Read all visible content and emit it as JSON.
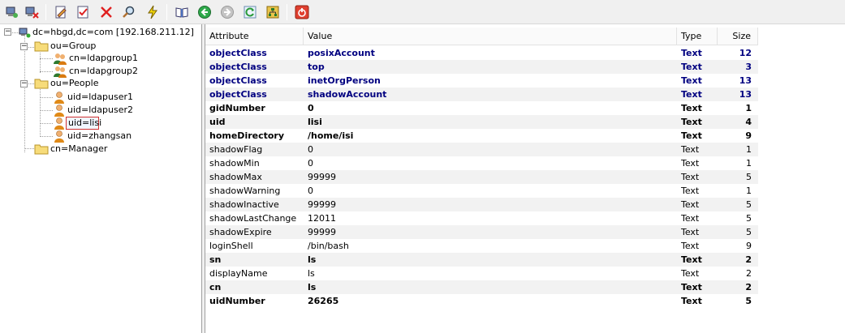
{
  "toolbar": {
    "buttons": [
      {
        "name": "connect-icon"
      },
      {
        "name": "disconnect-icon"
      },
      {
        "name": "edit-entry-icon"
      },
      {
        "name": "save-entry-icon"
      },
      {
        "name": "delete-icon"
      },
      {
        "name": "search-icon"
      },
      {
        "name": "execute-icon"
      },
      {
        "name": "book-icon"
      },
      {
        "name": "back-icon"
      },
      {
        "name": "forward-icon"
      },
      {
        "name": "refresh-icon"
      },
      {
        "name": "tree-view-icon"
      },
      {
        "name": "power-icon"
      }
    ]
  },
  "tree": {
    "root": "dc=hbgd,dc=com [192.168.211.12]",
    "group": "ou=Group",
    "group_items": [
      "cn=ldapgroup1",
      "cn=ldapgroup2"
    ],
    "people": "ou=People",
    "people_items": [
      "uid=ldapuser1",
      "uid=ldapuser2",
      "uid=lisi",
      "uid=zhangsan"
    ],
    "manager": "cn=Manager",
    "expanded_marker": "−"
  },
  "table": {
    "headers": {
      "attribute": "Attribute",
      "value": "Value",
      "type": "Type",
      "size": "Size"
    },
    "rows": [
      {
        "attr": "objectClass",
        "value": "posixAccount",
        "type": "Text",
        "size": "12",
        "style": "oc"
      },
      {
        "attr": "objectClass",
        "value": "top",
        "type": "Text",
        "size": "3",
        "style": "oc"
      },
      {
        "attr": "objectClass",
        "value": "inetOrgPerson",
        "type": "Text",
        "size": "13",
        "style": "oc"
      },
      {
        "attr": "objectClass",
        "value": "shadowAccount",
        "type": "Text",
        "size": "13",
        "style": "oc"
      },
      {
        "attr": "gidNumber",
        "value": "0",
        "type": "Text",
        "size": "1",
        "style": "bold"
      },
      {
        "attr": "uid",
        "value": "lisi",
        "type": "Text",
        "size": "4",
        "style": "bold"
      },
      {
        "attr": "homeDirectory",
        "value": "/home/isi",
        "type": "Text",
        "size": "9",
        "style": "bold"
      },
      {
        "attr": "shadowFlag",
        "value": "0",
        "type": "Text",
        "size": "1",
        "style": "normal"
      },
      {
        "attr": "shadowMin",
        "value": "0",
        "type": "Text",
        "size": "1",
        "style": "normal"
      },
      {
        "attr": "shadowMax",
        "value": "99999",
        "type": "Text",
        "size": "5",
        "style": "normal"
      },
      {
        "attr": "shadowWarning",
        "value": "0",
        "type": "Text",
        "size": "1",
        "style": "normal"
      },
      {
        "attr": "shadowInactive",
        "value": "99999",
        "type": "Text",
        "size": "5",
        "style": "normal"
      },
      {
        "attr": "shadowLastChange",
        "value": "12011",
        "type": "Text",
        "size": "5",
        "style": "normal"
      },
      {
        "attr": "shadowExpire",
        "value": "99999",
        "type": "Text",
        "size": "5",
        "style": "normal"
      },
      {
        "attr": "loginShell",
        "value": "/bin/bash",
        "type": "Text",
        "size": "9",
        "style": "normal"
      },
      {
        "attr": "sn",
        "value": "ls",
        "type": "Text",
        "size": "2",
        "style": "bold"
      },
      {
        "attr": "displayName",
        "value": "ls",
        "type": "Text",
        "size": "2",
        "style": "normal"
      },
      {
        "attr": "cn",
        "value": "ls",
        "type": "Text",
        "size": "2",
        "style": "bold"
      },
      {
        "attr": "uidNumber",
        "value": "26265",
        "type": "Text",
        "size": "5",
        "style": "bold"
      }
    ]
  }
}
